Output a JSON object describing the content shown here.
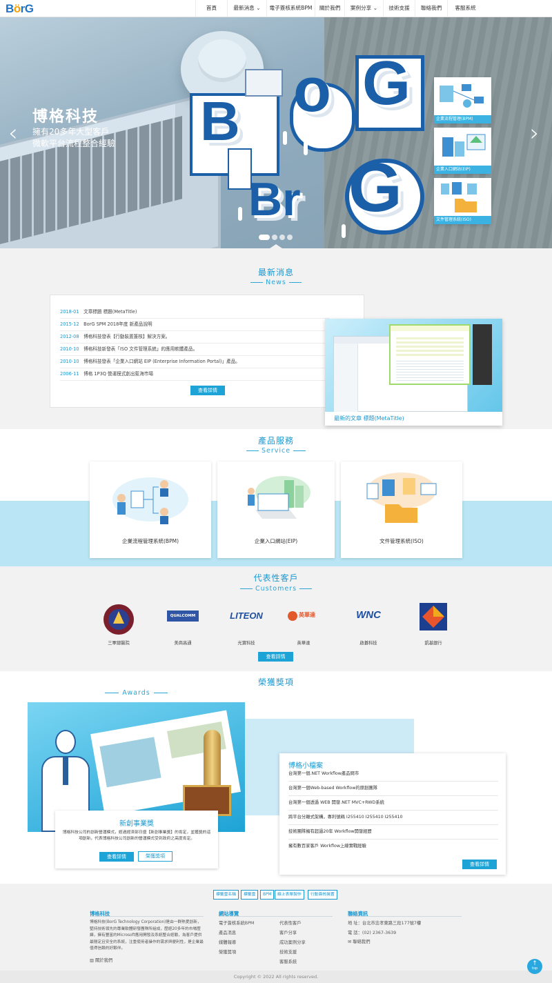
{
  "brand": {
    "logo_prefix": "B",
    "logo_o": "ö",
    "logo_suffix": "rG"
  },
  "nav": {
    "items": [
      {
        "label": "首頁",
        "dropdown": false
      },
      {
        "label": "最新消息",
        "dropdown": true
      },
      {
        "label": "電子簽核系統BPM",
        "dropdown": false
      },
      {
        "label": "關於我們",
        "dropdown": false
      },
      {
        "label": "案例分享",
        "dropdown": true
      },
      {
        "label": "技術支援",
        "dropdown": false
      },
      {
        "label": "聯絡我們",
        "dropdown": false
      },
      {
        "label": "客服系統",
        "dropdown": false
      }
    ]
  },
  "hero": {
    "title": "博格科技",
    "subtitle_line1": "擁有20多年大型客戶",
    "subtitle_line2": "微軟平台流程整合經驗",
    "art_text": [
      "B",
      "o",
      "r",
      "G",
      "Br",
      "G"
    ],
    "prev_icon": "chevron-left-icon",
    "next_icon": "chevron-right-icon",
    "cards": [
      {
        "label": "企業流程管理(BPM)"
      },
      {
        "label": "企業入口網站(EIP)"
      },
      {
        "label": "文件管理系統(ISO)"
      }
    ],
    "slide_count": 4,
    "active_slide": 1
  },
  "news": {
    "title": "最新消息",
    "subtitle": "News",
    "items": [
      {
        "date": "2018-01",
        "text": "文章標題 標題(MetaTitle)"
      },
      {
        "date": "2015-12",
        "text": "BorG SPM 2018年度 新產品說明"
      },
      {
        "date": "2012-08",
        "text": "博格科技發表【行動裝置簽核】解決方案。"
      },
      {
        "date": "2010-10",
        "text": "博格科技新發表「ISO 文件管理系統」的應用軟體產品。"
      },
      {
        "date": "2010-10",
        "text": "博格科技發表「企業入口網站 EIP (Enterprise Information Portal)」產品。"
      },
      {
        "date": "2006-11",
        "text": "博格 1P3Q 營運模式創出藍海市場"
      }
    ],
    "more_label": "查看詳情",
    "featured_caption": "最新的文章 標題(MetaTitle)"
  },
  "service": {
    "title": "產品服務",
    "subtitle": "Service",
    "items": [
      {
        "label": "企業流程管理系統(BPM)"
      },
      {
        "label": "企業入口網站(EIP)"
      },
      {
        "label": "文件管理系統(ISO)"
      }
    ]
  },
  "customers": {
    "title": "代表性客戶",
    "subtitle": "Customers",
    "items": [
      {
        "name": "三軍總醫院",
        "logo_text": ""
      },
      {
        "name": "美商高通",
        "logo_text": "QUALCOMM"
      },
      {
        "name": "光寶科技",
        "logo_text": "LITEON"
      },
      {
        "name": "英華達",
        "logo_text": "英華達"
      },
      {
        "name": "啟碁科技",
        "logo_text": "WNC"
      },
      {
        "name": "凱基銀行",
        "logo_text": ""
      }
    ],
    "more_label": "查看詳情"
  },
  "awards": {
    "title": "榮獲獎項",
    "subtitle": "Awards",
    "card_title": "新創事業獎",
    "card_text": "博格科技公司的創新營運模式，經過經濟部日盛【新創事業獎】的肯定，並獲獎的這項創新，代表博格科技公司創新的營運模式受到政府之高度肯定。",
    "more_label": "查看詳情",
    "awards_label": "榮獲獎項"
  },
  "profile": {
    "title": "博格小檔案",
    "items": [
      "台灣第一個.NET Workflow產品問市",
      "台灣第一個Web-based Workflow的原創團隊",
      "台灣第一個透過 WEB 開發.NET MVC+RWD系統",
      "跨平台分離式架構，專利號碼 I255410 I255410 I255410",
      "技術團隊擁有超過20年 Workflow開發經歷",
      "擁有數百家客戶 Workflow上線實戰經驗"
    ],
    "more_label": "查看詳情"
  },
  "footer": {
    "tags": [
      "標籤雲名稱",
      "標籤雲",
      "BPM",
      "線上表單製作",
      "行動簽核裝置"
    ],
    "about_title": "博格科技",
    "about_text": "博格科技(BorG Technology Corporation)是由一群熱愛創新，堅持技術領先的專業軟體研發團隊所組成，歷經20多年的市場歷練，擁有豐富的Microsoft應用開發及系統整合經驗，為客戶提供最穩定且安全的系統，注重使用者操作的需求與便利性，是企業最值得信賴的好夥伴。",
    "about_link": "關於我們",
    "sitemap_title": "網站導覽",
    "sitemap_col1": [
      "電子簽核系統BPM",
      "產品消息",
      "媒體報導",
      "榮獲獎項"
    ],
    "sitemap_col2": [
      "代表性客戶",
      "客戶分享",
      "成功案例分享",
      "技術支援",
      "客服系統"
    ],
    "contact_title": "聯絡資訊",
    "contact_address": "地 址：台北市忠孝東路三段177號7樓",
    "contact_phone": "電 話：(02) 2367-3639",
    "contact_link": "聯絡我們",
    "copyright": "Copyright © 2022 All rights reserved.",
    "top_label": "top"
  },
  "colors": {
    "brand_blue": "#1b97cf",
    "logo_blue": "#1f73c8",
    "logo_orange": "#f4a100",
    "button_blue": "#1ea3d6"
  }
}
